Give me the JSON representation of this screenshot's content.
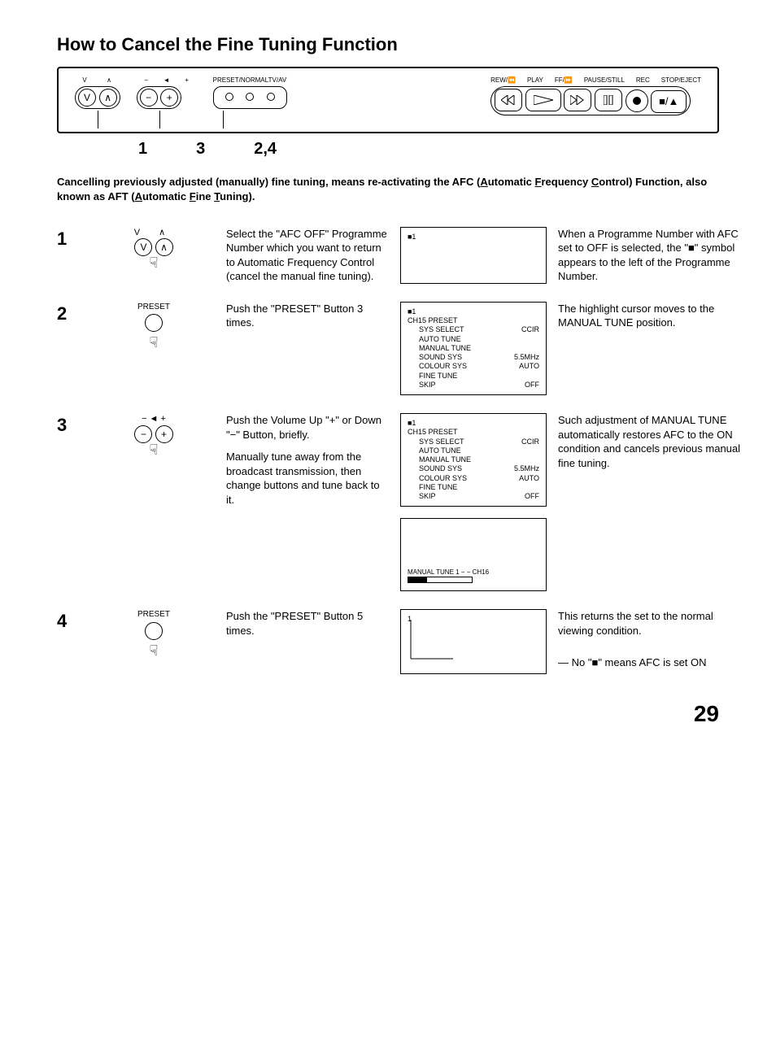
{
  "title": "How to Cancel the Fine Tuning Function",
  "panel": {
    "labels_left": [
      "V",
      "∧",
      "−",
      "◄",
      "+",
      "PRESET/NORMAL",
      "TV/AV"
    ],
    "labels_right": [
      "REW/⏪",
      "PLAY",
      "FF/⏩",
      "PAUSE/STILL",
      "REC",
      "STOP/EJECT"
    ],
    "callouts": [
      "1",
      "3",
      "2,4"
    ]
  },
  "intro": "Cancelling previously adjusted (manually) fine tuning, means re-activating the AFC (Automatic Frequency Control) Function, also known as AFT (Automatic Fine Tuning).",
  "steps": {
    "s1": {
      "num": "1",
      "icon_label_top": "V   ∧",
      "instr": "Select the \"AFC OFF\" Programme Number which you want to return to Automatic Frequency Control (cancel the manual fine tuning).",
      "screen_lines": [
        "■1"
      ],
      "result": "When a Programme Number with AFC set to OFF is selected, the \"■\" symbol appears to the left of the Programme Number."
    },
    "s2": {
      "num": "2",
      "icon_label": "PRESET",
      "instr": "Push the \"PRESET\" Button 3 times.",
      "screen": {
        "top": "■1",
        "line2": "CH15   PRESET",
        "rows": [
          [
            "SYS SELECT",
            "CCIR"
          ],
          [
            "AUTO TUNE",
            ""
          ],
          [
            "MANUAL TUNE",
            ""
          ],
          [
            "SOUND SYS",
            "5.5MHz"
          ],
          [
            "COLOUR SYS",
            "AUTO"
          ],
          [
            "FINE TUNE",
            ""
          ],
          [
            "SKIP",
            "OFF"
          ]
        ]
      },
      "result": "The highlight cursor moves to the MANUAL TUNE position."
    },
    "s3": {
      "num": "3",
      "icon_label_top": "−  ◄  +",
      "instr1": "Push the Volume Up \"+\" or Down \"−\" Button, briefly.",
      "instr2": "Manually tune away from the broadcast transmission, then change buttons and tune back to it.",
      "screen1": {
        "top": "■1",
        "line2": "CH15   PRESET",
        "rows": [
          [
            "SYS SELECT",
            "CCIR"
          ],
          [
            "AUTO TUNE",
            ""
          ],
          [
            "MANUAL TUNE",
            ""
          ],
          [
            "SOUND SYS",
            "5.5MHz"
          ],
          [
            "COLOUR SYS",
            "AUTO"
          ],
          [
            "FINE TUNE",
            ""
          ],
          [
            "SKIP",
            "OFF"
          ]
        ]
      },
      "screen2_label": "MANUAL TUNE 1 − − CH16",
      "result": "Such adjustment of MANUAL TUNE automatically restores AFC to the ON condition and cancels previous manual fine tuning."
    },
    "s4": {
      "num": "4",
      "icon_label": "PRESET",
      "instr": "Push the \"PRESET\" Button 5 times.",
      "screen_lines": [
        "1"
      ],
      "result1": "This returns the set to the normal viewing condition.",
      "result2": "No \"■\" means AFC is set ON"
    }
  },
  "page_number": "29"
}
